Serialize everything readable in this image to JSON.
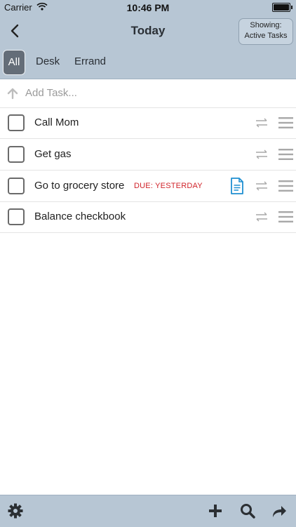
{
  "status_bar": {
    "carrier": "Carrier",
    "time": "10:46 PM",
    "wifi_icon": "wifi-icon",
    "battery_icon": "battery-icon"
  },
  "header": {
    "back_icon": "chevron-left-icon",
    "title": "Today",
    "showing": {
      "line1": "Showing:",
      "line2": "Active Tasks"
    }
  },
  "tabs": [
    {
      "label": "All",
      "active": true
    },
    {
      "label": "Desk",
      "active": false
    },
    {
      "label": "Errand",
      "active": false
    }
  ],
  "add_task": {
    "placeholder": "Add Task...",
    "value": "",
    "icon": "arrow-up-icon"
  },
  "tasks": [
    {
      "label": "Call Mom",
      "checked": false,
      "due": "",
      "has_note": false
    },
    {
      "label": "Get gas",
      "checked": false,
      "due": "",
      "has_note": false
    },
    {
      "label": "Go to grocery store",
      "checked": false,
      "due": "DUE: YESTERDAY",
      "has_note": true
    },
    {
      "label": "Balance checkbook",
      "checked": false,
      "due": "",
      "has_note": false
    }
  ],
  "toolbar": {
    "icons": [
      "gear-icon",
      "plus-icon",
      "search-icon",
      "share-icon"
    ]
  },
  "colors": {
    "header_bg": "#b7c6d4",
    "active_tab": "#646d78",
    "due_red": "#d0232a",
    "note_blue": "#1f8fd1",
    "icon_gray": "#a8a8a8"
  }
}
